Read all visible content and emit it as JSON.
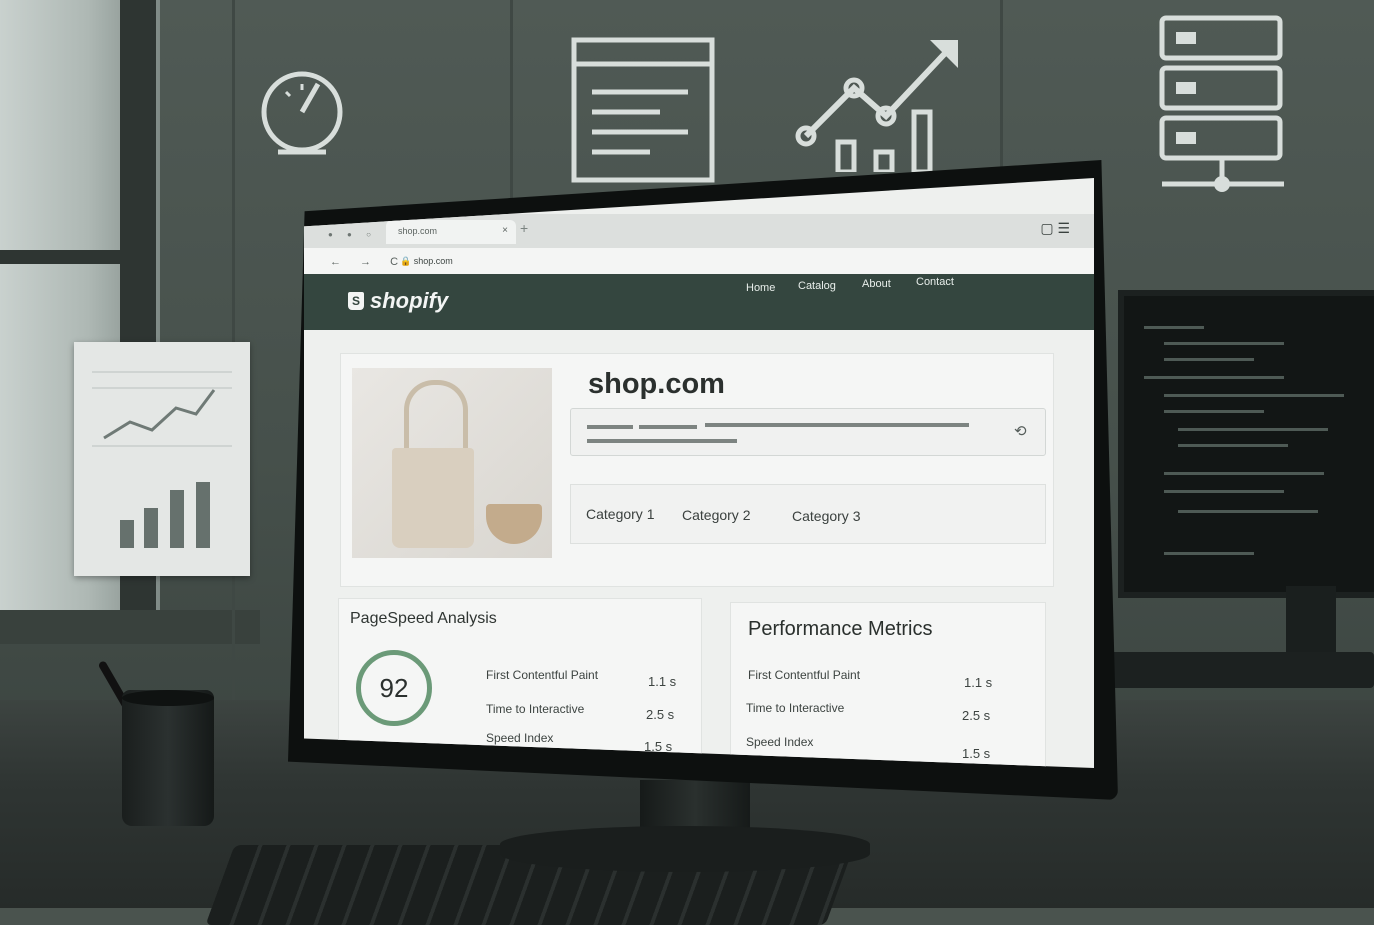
{
  "browser": {
    "tab_title": "shop.com",
    "tab_close": "×",
    "new_tab": "+",
    "url": "shop.com"
  },
  "site": {
    "logo_text": "shopify",
    "nav": [
      "Home",
      "Catalog",
      "About",
      "Contact"
    ],
    "title": "shop.com",
    "categories": [
      "Category 1",
      "Category 2",
      "Category 3"
    ]
  },
  "pagespeed": {
    "heading": "PageSpeed Analysis",
    "score": "92",
    "metrics": [
      {
        "label": "First Contentful Paint",
        "value": "1.1 s"
      },
      {
        "label": "Time to Interactive",
        "value": "2.5 s"
      },
      {
        "label": "Speed Index",
        "value": "1.5 s"
      }
    ]
  },
  "performance": {
    "heading": "Performance Metrics",
    "metrics": [
      {
        "label": "First Contentful Paint",
        "value": "1.1 s"
      },
      {
        "label": "Time to Interactive",
        "value": "2.5 s"
      },
      {
        "label": "Speed Index",
        "value": "1.5 s"
      }
    ]
  },
  "colors": {
    "header_green": "#34463f",
    "gauge_green": "#6b9a78"
  }
}
